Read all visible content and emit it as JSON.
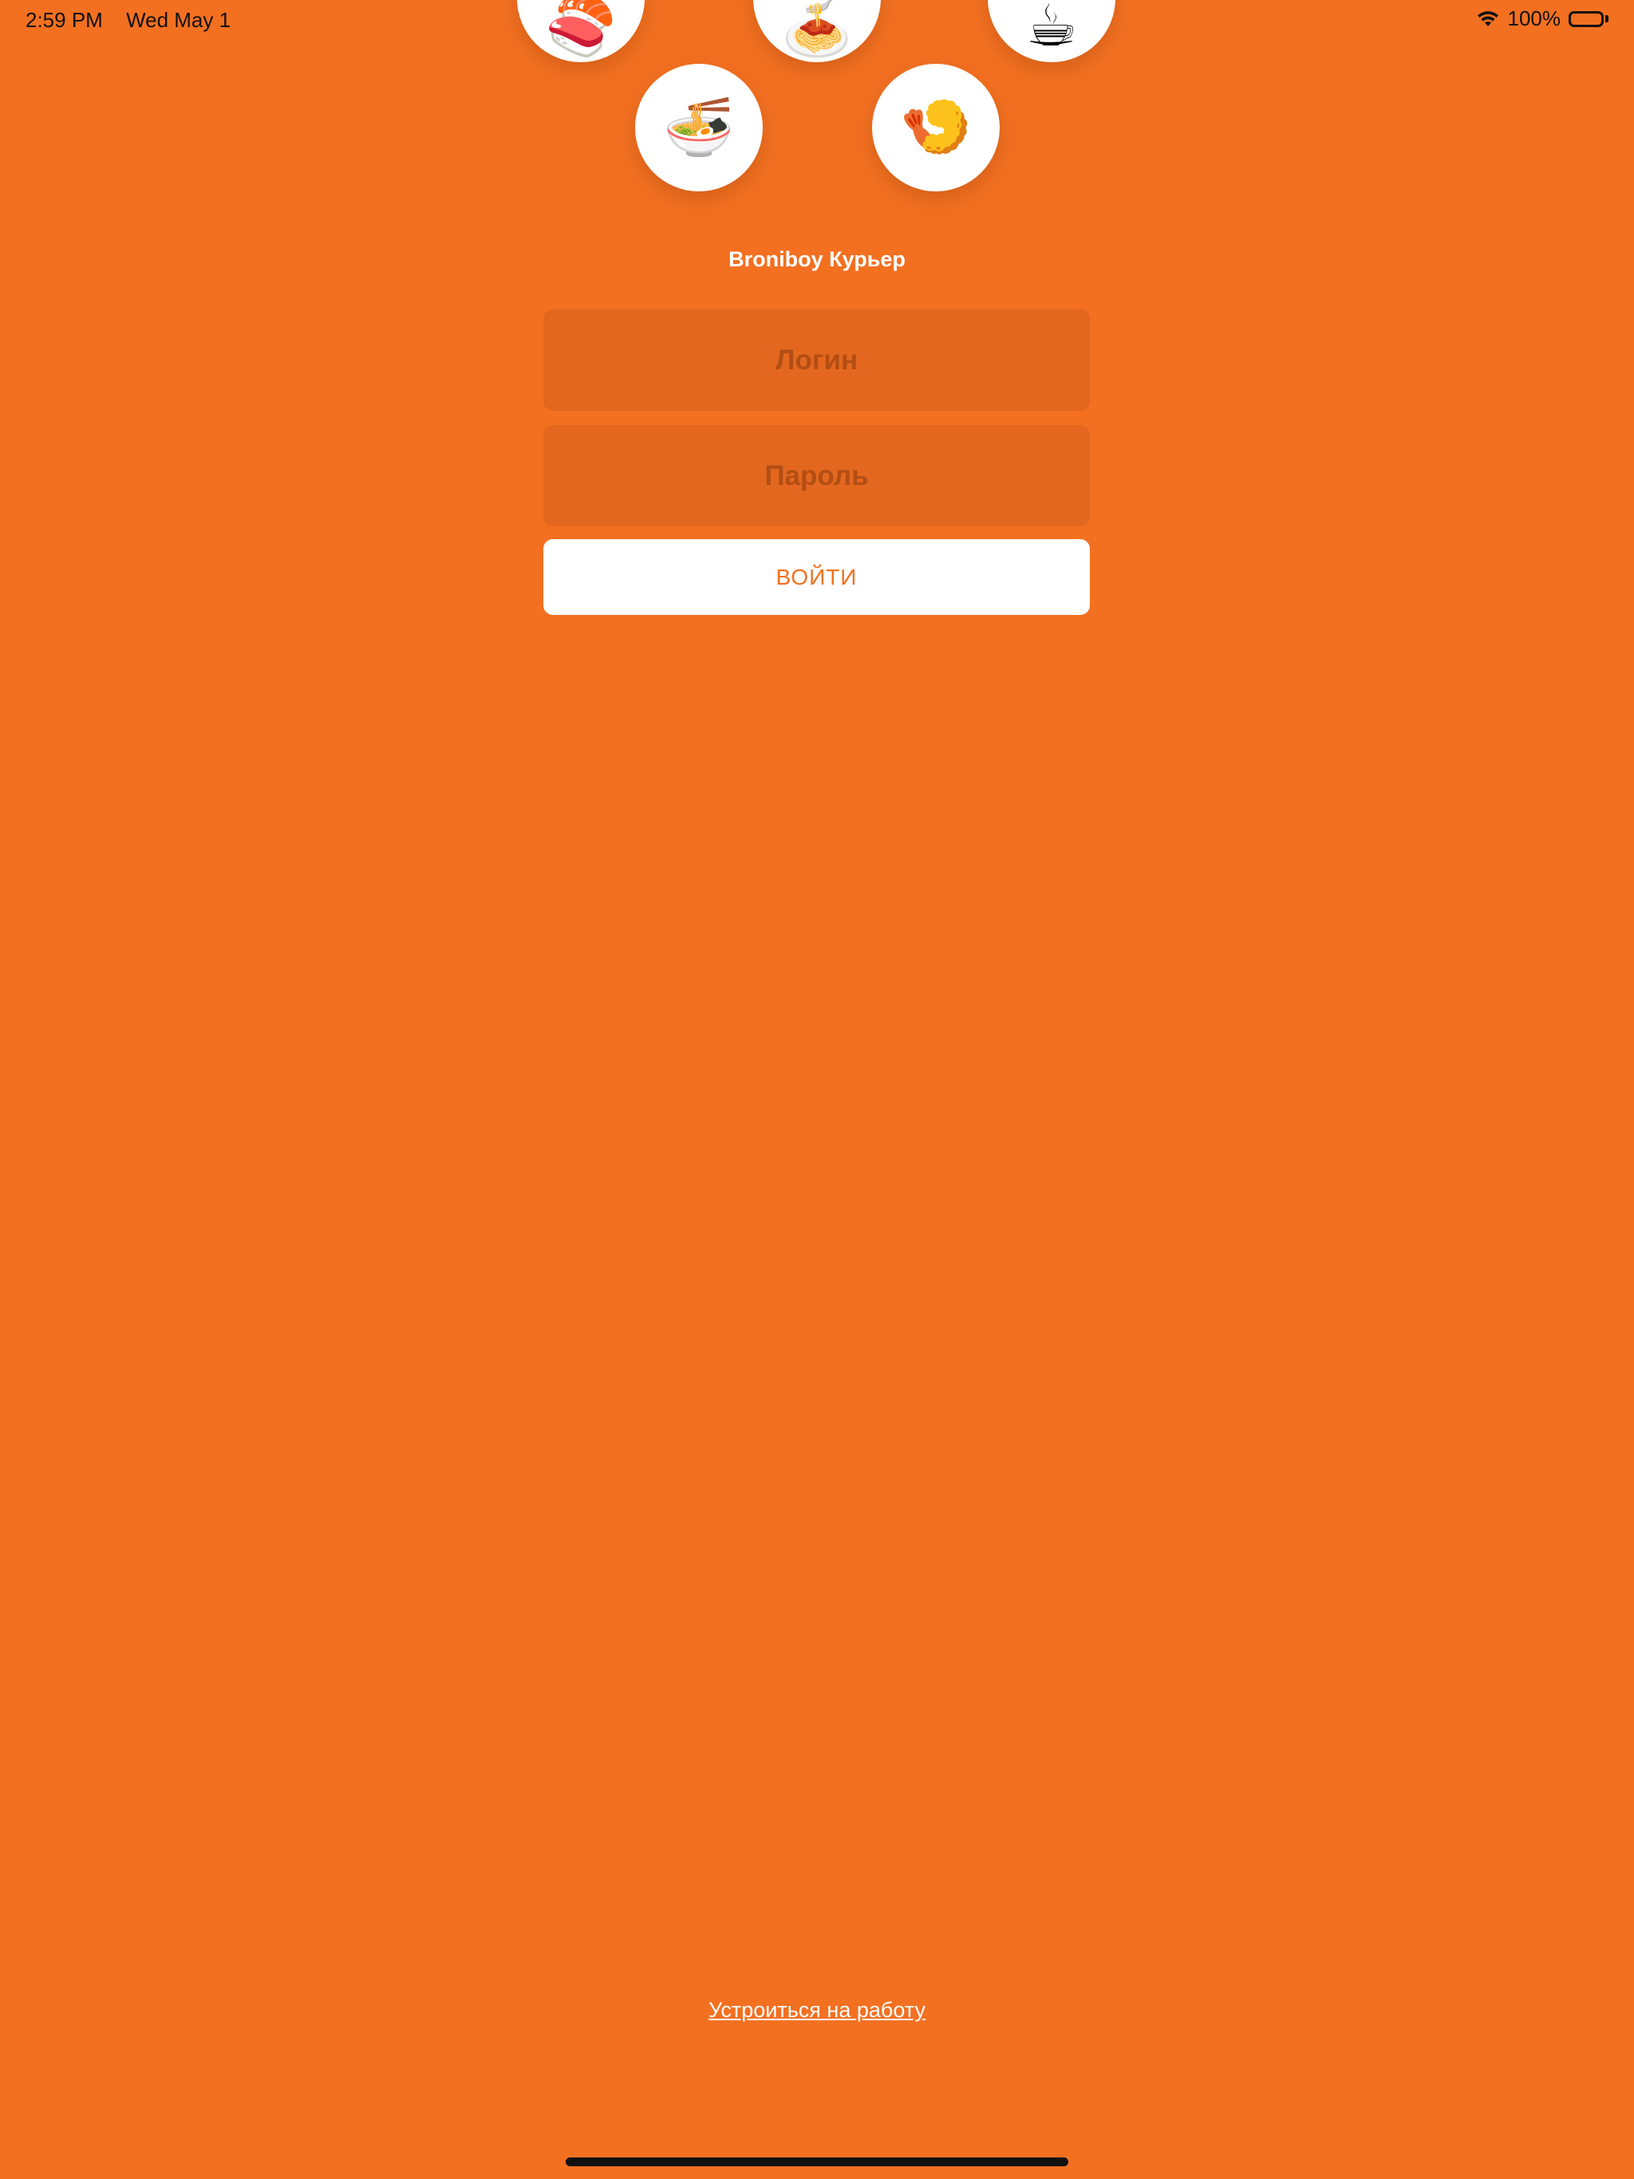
{
  "status_bar": {
    "time": "2:59 PM",
    "date": "Wed May 1",
    "battery": "100%",
    "icons": [
      "wifi-icon",
      "battery-icon"
    ]
  },
  "food_icons": [
    {
      "name": "sushi",
      "emoji": "🍣"
    },
    {
      "name": "spaghetti",
      "emoji": "🍝"
    },
    {
      "name": "coffee",
      "emoji": "☕"
    },
    {
      "name": "noodle-soup",
      "emoji": "🍜"
    },
    {
      "name": "fried-shrimp",
      "emoji": "🍤"
    }
  ],
  "app": {
    "title": "Broniboy Курьер"
  },
  "form": {
    "login_placeholder": "Логин",
    "password_placeholder": "Пароль",
    "submit_label": "ВОЙТИ"
  },
  "footer": {
    "job_link": "Устроиться на работу"
  },
  "colors": {
    "background": "#F37021",
    "field": "#E4671F",
    "field_text": "#B24E14",
    "button": "#FFFFFF",
    "button_text": "#F37021"
  }
}
